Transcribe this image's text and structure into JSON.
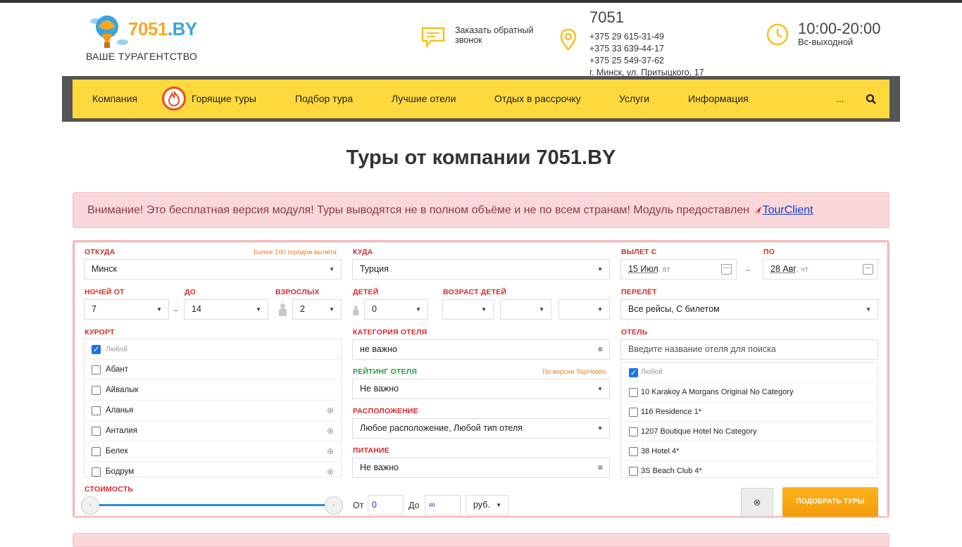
{
  "header": {
    "logo_text": "7051",
    "logo_suffix": ".BY",
    "tagline": "ВАШЕ ТУРАГЕНТСТВО",
    "callback": "Заказать обратный звонок",
    "contacts_title": "7051",
    "phones": [
      "+375 29 615-31-49",
      "+375 33 639-44-17",
      "+375 25 549-37-62"
    ],
    "address": "г. Минск, ул. Притыцкого, 17",
    "hours": "10:00-20:00",
    "days_off": "Вс-выходной"
  },
  "nav": {
    "items": [
      "Компания",
      "Горящие туры",
      "Подбор тура",
      "Лучшие отели",
      "Отдых в рассрочку",
      "Услуги",
      "Информация",
      "..."
    ]
  },
  "page": {
    "title": "Туры от компании 7051.BY",
    "alert": "Внимание! Это бесплатная версия модуля! Туры выводятся не в полном объёме и не по всем странам! Модуль предоставлен",
    "alert_link": "TourClient"
  },
  "form": {
    "from_label": "ОТКУДА",
    "from_hint": "Более 100 городов вылета",
    "from_value": "Минск",
    "to_label": "КУДА",
    "to_value": "Турция",
    "depart_label": "ВЫЛЕТ С",
    "depart_date": "15 Июл",
    "depart_wd": ", вт",
    "until_label": "ПО",
    "until_date": "28 Авг",
    "until_wd": ", чт",
    "nights_from_label": "НОЧЕЙ ОТ",
    "nights_from": "7",
    "nights_to_label": "ДО",
    "nights_to": "14",
    "adults_label": "ВЗРОСЛЫХ",
    "adults": "2",
    "children_label": "ДЕТЕЙ",
    "children": "0",
    "child_age_label": "ВОЗРАСТ ДЕТЕЙ",
    "flight_label": "ПЕРЕЛЁТ",
    "flight_value": "Все рейсы, С билетом",
    "resort_label": "КУРОРТ",
    "resorts": [
      "Любой",
      "Абант",
      "Айвалык",
      "Аланья",
      "Анталия",
      "Белек",
      "Бодрум"
    ],
    "category_label": "КАТЕГОРИЯ ОТЕЛЯ",
    "category_value": "не важно",
    "rating_label": "РЕЙТИНГ ОТЕЛЯ",
    "rating_hint": "По версии TopHotels",
    "rating_value": "Не важно",
    "location_label": "РАСПОЛОЖЕНИЕ",
    "location_value": "Любое расположение, Любой тип отеля",
    "meal_label": "ПИТАНИЕ",
    "meal_value": "Не важно",
    "hotel_label": "ОТЕЛЬ",
    "hotel_placeholder": "Введите название отеля для поиска",
    "hotels": [
      "Любой",
      "10 Karakoy A Morgans Original No Category",
      "116 Residence 1*",
      "1207 Boutique Hotel No Category",
      "38 Hotel 4*",
      "3S Beach Club 4*"
    ],
    "price_label": "СТОИМОСТЬ",
    "price_from_label": "От",
    "price_from": "0",
    "price_to_label": "До",
    "price_to": "∞",
    "currency": "руб.",
    "submit_label": "ПОДОБРАТЬ ТУРЫ"
  }
}
